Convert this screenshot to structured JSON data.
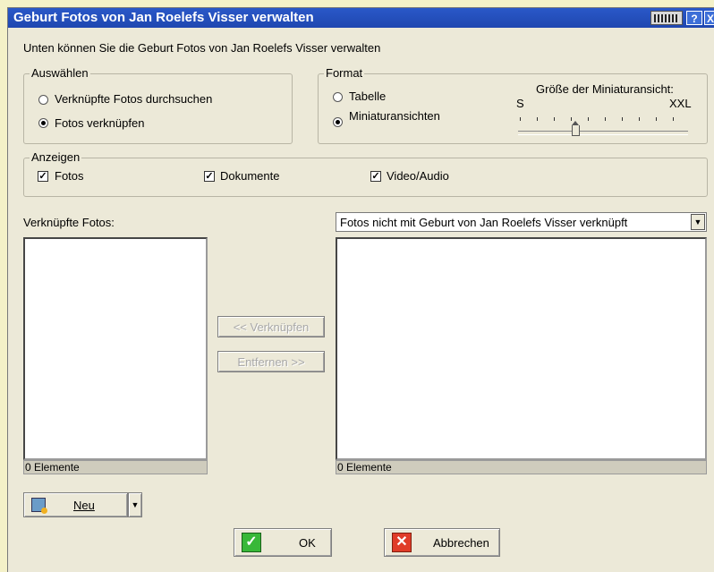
{
  "window": {
    "title": "Geburt Fotos von Jan Roelefs Visser verwalten",
    "help_label": "?",
    "close_label": "X"
  },
  "intro_text": "Unten können Sie die Geburt Fotos von Jan Roelefs Visser verwalten",
  "auswaehlen": {
    "legend": "Auswählen",
    "options": [
      {
        "label": "Verknüpfte Fotos durchsuchen",
        "selected": false
      },
      {
        "label": "Fotos verknüpfen",
        "selected": true
      }
    ]
  },
  "format": {
    "legend": "Format",
    "options": [
      {
        "label": "Tabelle",
        "selected": false
      },
      {
        "label": "Miniaturansichten",
        "selected": true
      }
    ],
    "thumbnail_size": {
      "label": "Größe der Miniaturansicht:",
      "min_label": "S",
      "max_label": "XXL",
      "level": 0.36
    }
  },
  "anzeigen": {
    "legend": "Anzeigen",
    "items": [
      {
        "label": "Fotos",
        "checked": true
      },
      {
        "label": "Dokumente",
        "checked": true
      },
      {
        "label": "Video/Audio",
        "checked": true
      }
    ]
  },
  "linked": {
    "header": "Verknüpfte Fotos:",
    "status": "0 Elemente"
  },
  "unlinked": {
    "filter_value": "Fotos nicht mit Geburt von Jan Roelefs Visser verknüpft",
    "status": "0 Elemente"
  },
  "actions": {
    "link_label": "<< Verknüpfen",
    "remove_label": "Entfernen >>"
  },
  "new_button": {
    "label": "Neu"
  },
  "footer": {
    "ok_label": "OK",
    "cancel_label": "Abbrechen"
  },
  "icons": {
    "ok": "checkmark-icon",
    "cancel": "x-icon",
    "new": "new-photo-icon",
    "keyboard": "keyboard-icon"
  }
}
